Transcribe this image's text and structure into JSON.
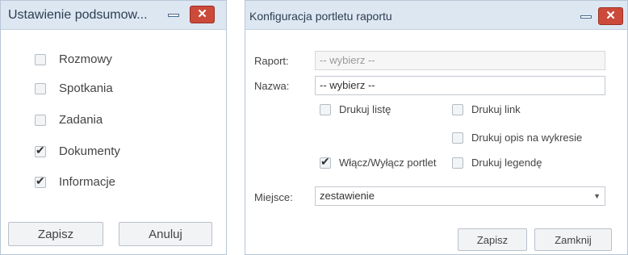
{
  "window1": {
    "title": "Ustawienie podsumow...",
    "checkboxes": [
      {
        "label": "Rozmowy",
        "checked": false
      },
      {
        "label": "Spotkania",
        "checked": false
      },
      {
        "label": "Zadania",
        "checked": false
      },
      {
        "label": "Dokumenty",
        "checked": true
      },
      {
        "label": "Informacje",
        "checked": true
      }
    ],
    "save_label": "Zapisz",
    "cancel_label": "Anuluj"
  },
  "window2": {
    "title": "Konfiguracja portletu raportu",
    "report_label": "Raport:",
    "report_value": "-- wybierz --",
    "name_label": "Nazwa:",
    "name_value": "-- wybierz --",
    "print_list": {
      "label": "Drukuj listę",
      "checked": false
    },
    "print_link": {
      "label": "Drukuj link",
      "checked": false
    },
    "print_chart_desc": {
      "label": "Drukuj opis na wykresie",
      "checked": false
    },
    "toggle_portlet": {
      "label": "Włącz/Wyłącz portlet",
      "checked": true
    },
    "print_legend": {
      "label": "Drukuj legendę",
      "checked": false
    },
    "place_label": "Miejsce:",
    "place_value": "zestawienie",
    "save_label": "Zapisz",
    "close_label": "Zamknij"
  },
  "icons": {
    "close": "close-icon",
    "minimize": "minimize-icon",
    "dropdown": "chevron-down-icon"
  },
  "colors": {
    "close_button": "#cc4a3a",
    "titlebar": "#dde7f2"
  }
}
